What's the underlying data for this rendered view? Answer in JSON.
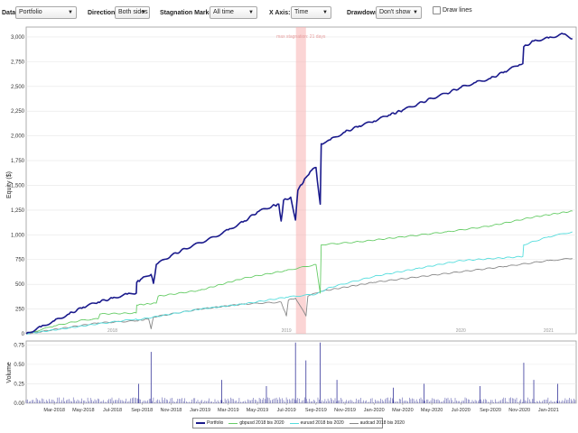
{
  "toolbar": {
    "data_label": "Data",
    "data_value": "Portfolio",
    "direction_label": "Direction:",
    "direction_value": "Both sides",
    "stagnation_label": "Stagnation Marker:",
    "stagnation_value": "All time",
    "xaxis_label": "X Axis:",
    "xaxis_value": "Time",
    "drawdown_label": "Drawdown:",
    "drawdown_value": "Don't show",
    "drawlines_label": "Draw lines",
    "chevron_icon": "chevron-down-icon"
  },
  "chart_data": [
    {
      "type": "line",
      "ylabel": "Equity ($)",
      "ylim": [
        0,
        3100
      ],
      "yticks": [
        0,
        250,
        500,
        750,
        1000,
        1250,
        1500,
        1750,
        2000,
        2250,
        2500,
        2750,
        3000
      ],
      "ytick_labels": [
        "0",
        "250",
        "500",
        "750",
        "1,000",
        "1,250",
        "1,500",
        "1,750",
        "2,000",
        "2,250",
        "2,500",
        "2,750",
        "3,000"
      ],
      "xlim": [
        "2018-01-01",
        "2021-02-28"
      ],
      "year_labels": [
        {
          "x": "2018-07-01",
          "label": "2018"
        },
        {
          "x": "2019-07-01",
          "label": "2019"
        },
        {
          "x": "2020-07-01",
          "label": "2020"
        },
        {
          "x": "2021-01-01",
          "label": "2021"
        }
      ],
      "stagnation": {
        "start": "2019-07-21",
        "end": "2019-08-11",
        "label": "max stagnation: 21 days"
      },
      "grid": true,
      "series": [
        {
          "name": "Portfolio",
          "color": "#1a1a8c",
          "points": [
            [
              "2018-01-01",
              0
            ],
            [
              "2018-02-01",
              70
            ],
            [
              "2018-03-01",
              130
            ],
            [
              "2018-04-01",
              200
            ],
            [
              "2018-05-01",
              270
            ],
            [
              "2018-06-01",
              320
            ],
            [
              "2018-07-01",
              360
            ],
            [
              "2018-08-01",
              400
            ],
            [
              "2018-08-20",
              410
            ],
            [
              "2018-08-21",
              520
            ],
            [
              "2018-09-01",
              560
            ],
            [
              "2018-09-20",
              600
            ],
            [
              "2018-09-25",
              510
            ],
            [
              "2018-10-01",
              700
            ],
            [
              "2018-11-01",
              790
            ],
            [
              "2018-12-01",
              860
            ],
            [
              "2019-01-01",
              920
            ],
            [
              "2019-02-01",
              980
            ],
            [
              "2019-03-01",
              1050
            ],
            [
              "2019-04-01",
              1130
            ],
            [
              "2019-05-01",
              1230
            ],
            [
              "2019-06-01",
              1290
            ],
            [
              "2019-06-15",
              1310
            ],
            [
              "2019-06-20",
              1140
            ],
            [
              "2019-06-25",
              1350
            ],
            [
              "2019-07-10",
              1380
            ],
            [
              "2019-07-20",
              1150
            ],
            [
              "2019-07-25",
              1450
            ],
            [
              "2019-08-11",
              1580
            ],
            [
              "2019-08-20",
              1640
            ],
            [
              "2019-09-01",
              1680
            ],
            [
              "2019-09-10",
              1310
            ],
            [
              "2019-09-12",
              1920
            ],
            [
              "2019-10-01",
              1960
            ],
            [
              "2019-11-01",
              2040
            ],
            [
              "2019-12-01",
              2100
            ],
            [
              "2020-01-01",
              2150
            ],
            [
              "2020-02-01",
              2210
            ],
            [
              "2020-03-01",
              2260
            ],
            [
              "2020-04-01",
              2320
            ],
            [
              "2020-05-01",
              2380
            ],
            [
              "2020-06-01",
              2430
            ],
            [
              "2020-07-01",
              2490
            ],
            [
              "2020-08-01",
              2540
            ],
            [
              "2020-09-01",
              2580
            ],
            [
              "2020-10-01",
              2650
            ],
            [
              "2020-11-01",
              2720
            ],
            [
              "2020-11-08",
              2730
            ],
            [
              "2020-11-10",
              2900
            ],
            [
              "2020-12-01",
              2960
            ],
            [
              "2021-01-01",
              2990
            ],
            [
              "2021-02-01",
              3030
            ],
            [
              "2021-02-20",
              2980
            ]
          ]
        },
        {
          "name": "gbpusd 2018 bis 2020",
          "color": "#66cc66",
          "points": [
            [
              "2018-01-01",
              0
            ],
            [
              "2018-03-01",
              80
            ],
            [
              "2018-05-01",
              140
            ],
            [
              "2018-06-01",
              150
            ],
            [
              "2018-06-05",
              200
            ],
            [
              "2018-08-20",
              210
            ],
            [
              "2018-08-21",
              290
            ],
            [
              "2018-10-01",
              310
            ],
            [
              "2018-10-05",
              380
            ],
            [
              "2019-01-01",
              440
            ],
            [
              "2019-04-01",
              560
            ],
            [
              "2019-07-01",
              640
            ],
            [
              "2019-09-01",
              700
            ],
            [
              "2019-09-10",
              410
            ],
            [
              "2019-09-12",
              900
            ],
            [
              "2019-12-01",
              930
            ],
            [
              "2020-03-01",
              980
            ],
            [
              "2020-06-01",
              1030
            ],
            [
              "2020-09-01",
              1090
            ],
            [
              "2020-12-01",
              1180
            ],
            [
              "2021-02-20",
              1240
            ]
          ]
        },
        {
          "name": "eurusd 2018 bis 2020",
          "color": "#55dddd",
          "points": [
            [
              "2018-01-01",
              0
            ],
            [
              "2018-06-01",
              100
            ],
            [
              "2018-08-20",
              150
            ],
            [
              "2018-08-21",
              140
            ],
            [
              "2019-01-01",
              250
            ],
            [
              "2019-04-01",
              300
            ],
            [
              "2019-07-01",
              370
            ],
            [
              "2019-09-01",
              400
            ],
            [
              "2019-10-01",
              470
            ],
            [
              "2020-01-01",
              580
            ],
            [
              "2020-04-01",
              660
            ],
            [
              "2020-07-01",
              740
            ],
            [
              "2020-11-08",
              780
            ],
            [
              "2020-11-10",
              900
            ],
            [
              "2021-01-01",
              980
            ],
            [
              "2021-02-20",
              1030
            ]
          ]
        },
        {
          "name": "audcad 2018 bis 2020",
          "color": "#888888",
          "points": [
            [
              "2018-01-01",
              0
            ],
            [
              "2018-06-01",
              110
            ],
            [
              "2018-08-20",
              130
            ],
            [
              "2018-09-15",
              150
            ],
            [
              "2018-09-20",
              50
            ],
            [
              "2018-09-25",
              170
            ],
            [
              "2019-01-01",
              250
            ],
            [
              "2019-04-01",
              300
            ],
            [
              "2019-06-20",
              320
            ],
            [
              "2019-07-01",
              180
            ],
            [
              "2019-07-05",
              340
            ],
            [
              "2019-07-20",
              360
            ],
            [
              "2019-08-11",
              180
            ],
            [
              "2019-08-15",
              380
            ],
            [
              "2019-09-12",
              430
            ],
            [
              "2020-01-01",
              520
            ],
            [
              "2020-06-01",
              610
            ],
            [
              "2020-10-01",
              680
            ],
            [
              "2021-01-01",
              740
            ],
            [
              "2021-02-20",
              760
            ]
          ]
        }
      ]
    },
    {
      "type": "bar",
      "ylabel": "Volume",
      "ylim": [
        0,
        0.8
      ],
      "yticks": [
        0,
        0.25,
        0.5,
        0.75
      ],
      "ytick_labels": [
        "0.00",
        "0.25",
        "0.50",
        "0.75"
      ],
      "xlim": [
        "2018-01-01",
        "2021-02-28"
      ],
      "xtick_labels": [
        "Mar-2018",
        "May-2018",
        "Jul-2018",
        "Sep-2018",
        "Nov-2018",
        "Jan-2019",
        "Mar-2019",
        "May-2019",
        "Jul-2019",
        "Sep-2019",
        "Nov-2019",
        "Jan-2020",
        "Mar-2020",
        "May-2020",
        "Jul-2020",
        "Sep-2020",
        "Nov-2020",
        "Jan-2021"
      ],
      "color": "#1a1a8c",
      "baseline": 0.04,
      "spikes": [
        [
          "2018-09-20",
          0.66
        ],
        [
          "2018-08-25",
          0.25
        ],
        [
          "2019-02-15",
          0.3
        ],
        [
          "2019-05-20",
          0.22
        ],
        [
          "2019-07-20",
          0.78
        ],
        [
          "2019-08-11",
          0.55
        ],
        [
          "2019-09-10",
          0.78
        ],
        [
          "2019-10-15",
          0.3
        ],
        [
          "2020-02-10",
          0.2
        ],
        [
          "2020-04-15",
          0.25
        ],
        [
          "2020-08-10",
          0.22
        ],
        [
          "2020-11-10",
          0.52
        ],
        [
          "2020-12-01",
          0.3
        ],
        [
          "2021-01-20",
          0.25
        ]
      ]
    }
  ],
  "legend": {
    "items": [
      {
        "label": "Portfolio",
        "color": "#1a1a8c",
        "thick": true
      },
      {
        "label": "gbpusd 2018 bis 2020",
        "color": "#66cc66",
        "thick": false
      },
      {
        "label": "eurusd 2018 bis 2020",
        "color": "#55dddd",
        "thick": false
      },
      {
        "label": "audcad 2018 bis 2020",
        "color": "#888888",
        "thick": false
      }
    ]
  }
}
